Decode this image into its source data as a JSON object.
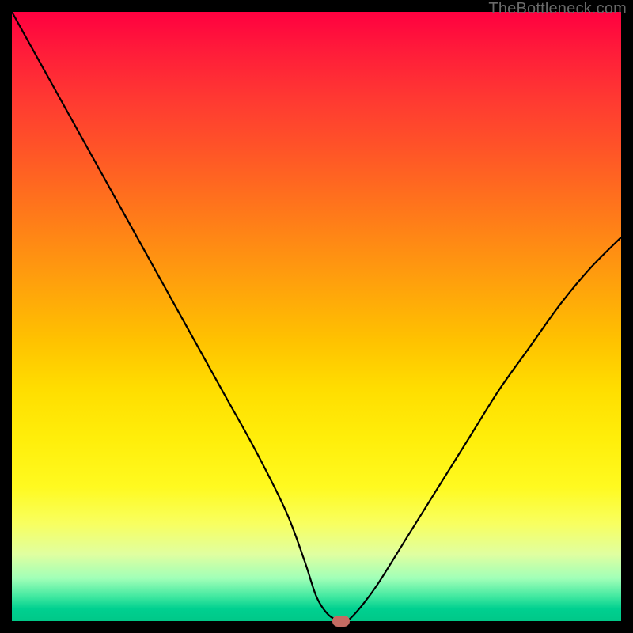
{
  "watermark": "TheBottleneck.com",
  "chart_data": {
    "type": "line",
    "title": "",
    "xlabel": "",
    "ylabel": "",
    "xlim": [
      0,
      100
    ],
    "ylim": [
      0,
      100
    ],
    "series": [
      {
        "name": "bottleneck-curve",
        "x": [
          0,
          5,
          10,
          15,
          20,
          25,
          30,
          35,
          40,
          45,
          48,
          50,
          52,
          54,
          55,
          57,
          60,
          65,
          70,
          75,
          80,
          85,
          90,
          95,
          100
        ],
        "values": [
          100,
          91,
          82,
          73,
          64,
          55,
          46,
          37,
          28,
          18,
          10,
          4,
          1,
          0,
          0,
          2,
          6,
          14,
          22,
          30,
          38,
          45,
          52,
          58,
          63
        ]
      }
    ],
    "marker": {
      "x": 54,
      "y": 0,
      "name": "optimal-point"
    },
    "gradient_colors": {
      "top": "#ff0040",
      "mid": "#ffde00",
      "bottom": "#00c888"
    }
  }
}
